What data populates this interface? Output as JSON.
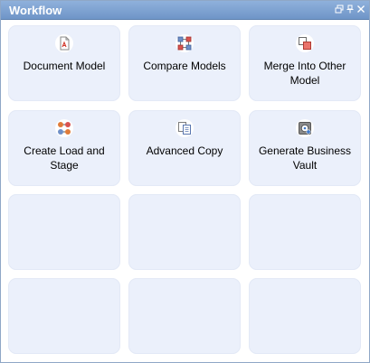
{
  "window": {
    "title": "Workflow",
    "buttons": {
      "restore_icon": "restore-icon",
      "pin_icon": "pin-icon",
      "close_icon": "close-icon"
    }
  },
  "tiles": [
    {
      "label": "Document Model",
      "icon": "document-model-icon"
    },
    {
      "label": "Compare Models",
      "icon": "compare-models-icon"
    },
    {
      "label": "Merge Into Other Model",
      "icon": "merge-model-icon"
    },
    {
      "label": "Create Load and Stage",
      "icon": "create-load-stage-icon"
    },
    {
      "label": "Advanced Copy",
      "icon": "advanced-copy-icon"
    },
    {
      "label": "Generate Business Vault",
      "icon": "generate-business-vault-icon"
    }
  ],
  "colors": {
    "titlebar": "#7a9ccf",
    "tile_background": "#ebf0fb",
    "border": "#8fa7c6"
  }
}
